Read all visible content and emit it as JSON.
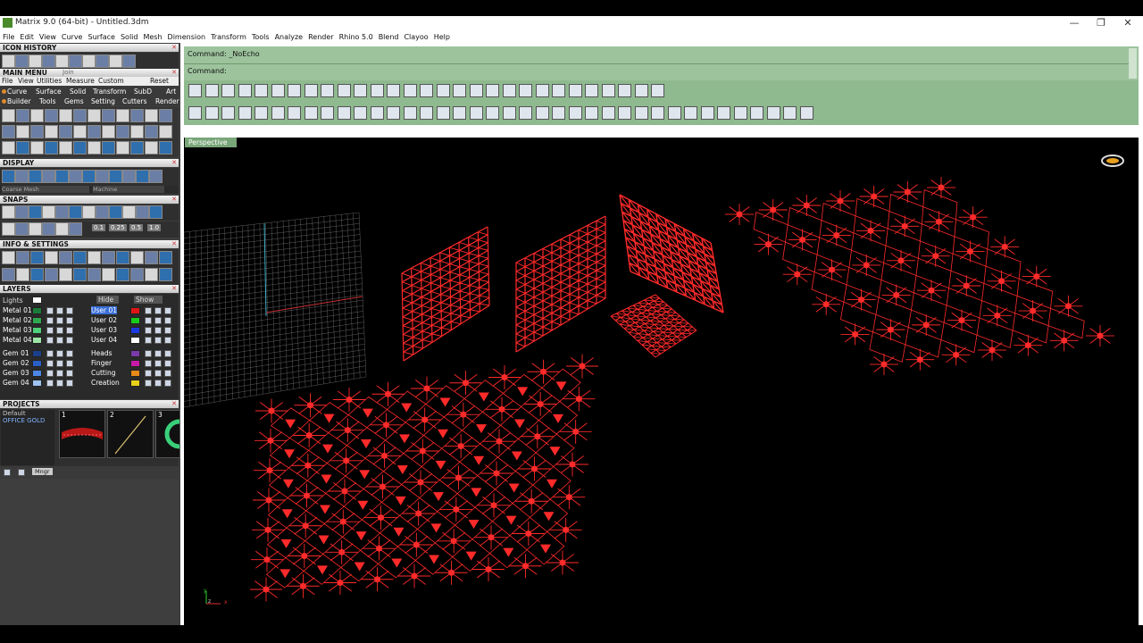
{
  "window": {
    "title": "Matrix 9.0 (64-bit) - Untitled.3dm",
    "minimize": "—",
    "maximize": "❐",
    "close": "✕"
  },
  "menubar": [
    "File",
    "Edit",
    "View",
    "Curve",
    "Surface",
    "Solid",
    "Mesh",
    "Dimension",
    "Transform",
    "Tools",
    "Analyze",
    "Render",
    "Rhino 5.0",
    "Blend",
    "Clayoo",
    "Help"
  ],
  "left_panel": {
    "icon_history": "ICON HISTORY",
    "main_menu": "MAIN MENU",
    "join": "Join",
    "main_menu_bar": [
      "File",
      "View",
      "Utilities",
      "Measure",
      "Custom",
      "Reset"
    ],
    "category_row1": [
      "Curve",
      "Surface",
      "Solid",
      "Transform",
      "SubD",
      "Art"
    ],
    "category_row2": [
      "Builder",
      "Tools",
      "Gems",
      "Setting",
      "Cutters",
      "Render"
    ],
    "display": "DISPLAY",
    "display_modes": [
      "Coarse Mesh",
      "Machine"
    ],
    "snaps": "SNAPS",
    "snap_values": [
      "0.1",
      "0.25",
      "0.5",
      "1.0"
    ],
    "info_settings": "INFO & SETTINGS",
    "layers": "LAYERS",
    "layer_header": {
      "first": "Lights",
      "hide": "Hide",
      "show": "Show"
    },
    "layers_left": [
      "Metal 01",
      "Metal 02",
      "Metal 03",
      "Metal 04",
      "Gem 01",
      "Gem 02",
      "Gem 03",
      "Gem 04"
    ],
    "layers_right": [
      "User 01",
      "User 02",
      "User 03",
      "User 04",
      "Heads",
      "Finger",
      "Cutting",
      "Creation"
    ],
    "layer_colors_left": [
      "#1c7c3a",
      "#2fa84f",
      "#4fd07a",
      "#9ee6a6",
      "#1a3f8c",
      "#2b5fc8",
      "#4c86e6",
      "#9ec3f2"
    ],
    "layer_colors_right": [
      "#e01616",
      "#1acc1a",
      "#1a3ae0",
      "#ffffff",
      "#7a3aa8",
      "#c81aa8",
      "#e88a1a",
      "#e8d01a"
    ],
    "projects": "PROJECTS",
    "project_items": [
      "Default",
      "OFFICE GOLD"
    ],
    "thumb_numbers": [
      "1",
      "2",
      "3"
    ],
    "mngr": "Mngr"
  },
  "command": {
    "line1": "Command: _NoEcho",
    "line2": "Command:"
  },
  "viewport": {
    "label": "Perspective",
    "axis_labels": [
      "y",
      "z",
      "x"
    ]
  },
  "colors": {
    "command_bg": "#9dc39d",
    "toolbar_bg": "#8fb98f",
    "geometry": "#ff2a2a",
    "grid": "#9a9a9a"
  }
}
